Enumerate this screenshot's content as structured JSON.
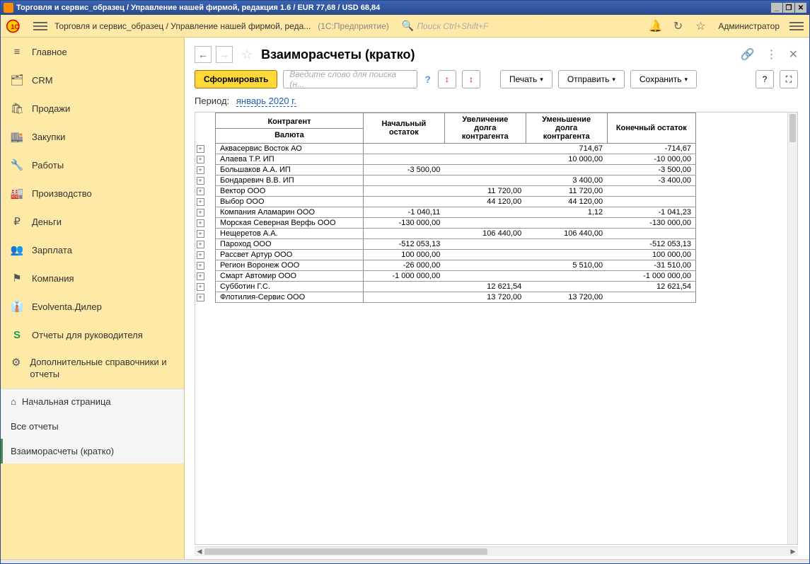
{
  "window": {
    "title": "Торговля и сервис_образец / Управление нашей фирмой, редакция 1.6 / EUR 77,68 / USD 68,84"
  },
  "appbar": {
    "breadcrumb": "Торговля и сервис_образец / Управление нашей фирмой, реда...",
    "platform": "(1С:Предприятие)",
    "search_placeholder": "Поиск Ctrl+Shift+F",
    "user": "Администратор"
  },
  "sidebar": {
    "items": [
      {
        "label": "Главное"
      },
      {
        "label": "CRM"
      },
      {
        "label": "Продажи"
      },
      {
        "label": "Закупки"
      },
      {
        "label": "Работы"
      },
      {
        "label": "Производство"
      },
      {
        "label": "Деньги"
      },
      {
        "label": "Зарплата"
      },
      {
        "label": "Компания"
      },
      {
        "label": "Evolventa.Дилер"
      },
      {
        "label": "Отчеты для руководителя"
      },
      {
        "label": "Дополнительные справочники и отчеты"
      }
    ],
    "secondary": [
      {
        "label": "Начальная страница"
      },
      {
        "label": "Все отчеты"
      },
      {
        "label": "Взаиморасчеты (кратко)"
      }
    ]
  },
  "main": {
    "title": "Взаиморасчеты (кратко)",
    "generate": "Сформировать",
    "search_placeholder": "Введите слово для поиска (н...",
    "print": "Печать",
    "send": "Отправить",
    "save": "Сохранить",
    "period_label": "Период:",
    "period_value": "январь 2020 г."
  },
  "report": {
    "headers": {
      "counterparty": "Контрагент",
      "currency": "Валюта",
      "start": "Начальный остаток",
      "increase": "Увеличение долга контрагента",
      "decrease": "Уменьшение долга контрагента",
      "end": "Конечный остаток"
    },
    "rows": [
      {
        "name": "Аквасервис Восток АО",
        "start": "",
        "inc": "",
        "dec": "714,67",
        "end": "-714,67"
      },
      {
        "name": "Алаева Т.Р. ИП",
        "start": "",
        "inc": "",
        "dec": "10 000,00",
        "end": "-10 000,00"
      },
      {
        "name": "Большаков А.А. ИП",
        "start": "-3 500,00",
        "inc": "",
        "dec": "",
        "end": "-3 500,00"
      },
      {
        "name": "Бондаревич В.В. ИП",
        "start": "",
        "inc": "",
        "dec": "3 400,00",
        "end": "-3 400,00"
      },
      {
        "name": "Вектор ООО",
        "start": "",
        "inc": "11 720,00",
        "dec": "11 720,00",
        "end": ""
      },
      {
        "name": "Выбор ООО",
        "start": "",
        "inc": "44 120,00",
        "dec": "44 120,00",
        "end": ""
      },
      {
        "name": "Компания Аламарин ООО",
        "start": "-1 040,11",
        "inc": "",
        "dec": "1,12",
        "end": "-1 041,23"
      },
      {
        "name": "Морская Северная Верфь ООО",
        "start": "-130 000,00",
        "inc": "",
        "dec": "",
        "end": "-130 000,00"
      },
      {
        "name": "Нещеретов А.А.",
        "start": "",
        "inc": "106 440,00",
        "dec": "106 440,00",
        "end": ""
      },
      {
        "name": "Пароход ООО",
        "start": "-512 053,13",
        "inc": "",
        "dec": "",
        "end": "-512 053,13"
      },
      {
        "name": "Рассвет Артур ООО",
        "start": "100 000,00",
        "inc": "",
        "dec": "",
        "end": "100 000,00"
      },
      {
        "name": "Регион Воронеж ООО",
        "start": "-26 000,00",
        "inc": "",
        "dec": "5 510,00",
        "end": "-31 510,00"
      },
      {
        "name": "Смарт Автомир ООО",
        "start": "-1 000 000,00",
        "inc": "",
        "dec": "",
        "end": "-1 000 000,00"
      },
      {
        "name": "Субботин Г.С.",
        "start": "",
        "inc": "12 621,54",
        "dec": "",
        "end": "12 621,54"
      },
      {
        "name": "Флотилия-Сервис ООО",
        "start": "",
        "inc": "13 720,00",
        "dec": "13 720,00",
        "end": ""
      }
    ]
  }
}
